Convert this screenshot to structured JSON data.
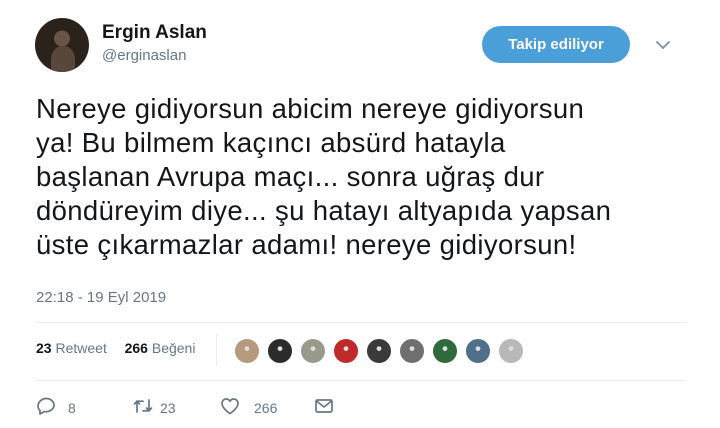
{
  "author": {
    "name": "Ergin Aslan",
    "handle": "@erginaslan"
  },
  "follow_button": {
    "label": "Takip ediliyor",
    "color": "#4a9fd8"
  },
  "tweet_lines": [
    "Nereye gidiyorsun abicim nereye gidiyorsun",
    "ya! Bu bilmem kaçıncı absürd hatayla",
    "başlanan Avrupa maçı... sonra uğraş dur",
    "döndüreyim diye... şu hatayı altyapıda yapsan",
    "üste çıkarmazlar adamı! nereye gidiyorsun!"
  ],
  "timestamp": "22:18 - 19 Eyl 2019",
  "stats": {
    "retweets_count": "23",
    "retweets_label": "Retweet",
    "likes_count": "266",
    "likes_label": "Beğeni"
  },
  "likers": [
    {
      "icon": "avatar-1",
      "color": "#b59a7e"
    },
    {
      "icon": "avatar-2",
      "color": "#2b2b2b"
    },
    {
      "icon": "avatar-3",
      "color": "#9a9a8c"
    },
    {
      "icon": "avatar-4",
      "color": "#c12a2a"
    },
    {
      "icon": "avatar-5",
      "color": "#3a3a3a"
    },
    {
      "icon": "avatar-6",
      "color": "#6f6f6f"
    },
    {
      "icon": "avatar-7",
      "color": "#2f6b3a"
    },
    {
      "icon": "avatar-8",
      "color": "#4f6f8a"
    },
    {
      "icon": "avatar-9",
      "color": "#b8b8b8"
    }
  ],
  "actions": {
    "reply_count": "8",
    "retweet_count": "23",
    "like_count": "266"
  },
  "icons": {
    "reply": "reply-icon",
    "retweet": "retweet-icon",
    "like": "heart-icon",
    "message": "message-icon",
    "caret": "chevron-down-icon"
  },
  "colors": {
    "text": "#14171a",
    "secondary": "#657786",
    "accent": "#4a9fd8"
  }
}
